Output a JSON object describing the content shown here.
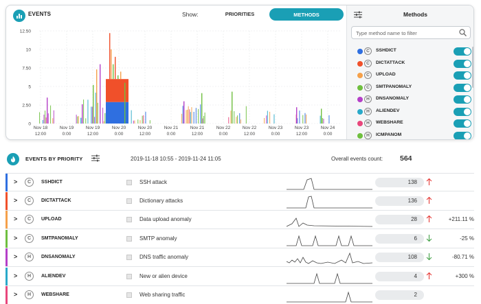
{
  "events_panel": {
    "title": "EVENTS",
    "show_label": "Show:",
    "buttons": {
      "priorities": "PRIORITIES",
      "methods": "METHODS"
    },
    "accent_color": "#1a9fb5",
    "chart_data": {
      "type": "bar",
      "stacked": true,
      "yticks": [
        "12.50",
        "10",
        "7.50",
        "5",
        "2.50",
        "0"
      ],
      "ylim": [
        0,
        12.5
      ],
      "xticks": [
        {
          "date": "Nov 18",
          "time": "12:00"
        },
        {
          "date": "Nov 19",
          "time": "0:00"
        },
        {
          "date": "Nov 19",
          "time": "12:00"
        },
        {
          "date": "Nov 20",
          "time": "0:00"
        },
        {
          "date": "Nov 20",
          "time": "12:00"
        },
        {
          "date": "Nov 21",
          "time": "0:00"
        },
        {
          "date": "Nov 21",
          "time": "12:00"
        },
        {
          "date": "Nov 22",
          "time": "0:00"
        },
        {
          "date": "Nov 22",
          "time": "12:00"
        },
        {
          "date": "Nov 23",
          "time": "0:00"
        },
        {
          "date": "Nov 23",
          "time": "12:00"
        },
        {
          "date": "Nov 24",
          "time": "0:00"
        }
      ],
      "grid": true,
      "series_colors": {
        "SSHDICT": "#2f6fe0",
        "DICTATTACK": "#f0502a",
        "UPLOAD": "#f5a04a",
        "SMTPANOMALY": "#6fbf3f",
        "DNSANOMALY": "#b43fc8",
        "ALIENDEV": "#29a9c9",
        "WEBSHARE": "#e8467c"
      }
    }
  },
  "methods_panel": {
    "title": "Methods",
    "search_placeholder": "Type method name to filter",
    "items": [
      {
        "name": "SSHDICT",
        "letter": "C",
        "color": "#2f6fe0",
        "enabled": true
      },
      {
        "name": "DICTATTACK",
        "letter": "C",
        "color": "#f0502a",
        "enabled": true
      },
      {
        "name": "UPLOAD",
        "letter": "C",
        "color": "#f5a04a",
        "enabled": true
      },
      {
        "name": "SMTPANOMALY",
        "letter": "C",
        "color": "#6fbf3f",
        "enabled": true
      },
      {
        "name": "DNSANOMALY",
        "letter": "H",
        "color": "#b43fc8",
        "enabled": true
      },
      {
        "name": "ALIENDEV",
        "letter": "H",
        "color": "#29a9c9",
        "enabled": true
      },
      {
        "name": "WEBSHARE",
        "letter": "H",
        "color": "#e8467c",
        "enabled": true
      },
      {
        "name": "ICMPANOM",
        "letter": "H",
        "color": "#6fbf3f",
        "enabled": true
      }
    ]
  },
  "priority_panel": {
    "title": "EVENTS BY PRIORITY",
    "time_range": "2019-11-18 10:55 - 2019-11-24 11:05",
    "overall_label": "Overall events count:",
    "overall_count": "564",
    "rows": [
      {
        "color": "#2f6fe0",
        "letter": "C",
        "name": "SSHDICT",
        "description": "SSH attack",
        "count": "138",
        "trend": "up",
        "change": ""
      },
      {
        "color": "#f0502a",
        "letter": "C",
        "name": "DICTATTACK",
        "description": "Dictionary attacks",
        "count": "136",
        "trend": "up",
        "change": ""
      },
      {
        "color": "#f5a04a",
        "letter": "C",
        "name": "UPLOAD",
        "description": "Data upload anomaly",
        "count": "28",
        "trend": "up",
        "change": "+211.11 %"
      },
      {
        "color": "#6fbf3f",
        "letter": "C",
        "name": "SMTPANOMALY",
        "description": "SMTP anomaly",
        "count": "6",
        "trend": "down",
        "change": "-25 %"
      },
      {
        "color": "#b43fc8",
        "letter": "H",
        "name": "DNSANOMALY",
        "description": "DNS traffic anomaly",
        "count": "108",
        "trend": "down",
        "change": "-80.71 %"
      },
      {
        "color": "#29a9c9",
        "letter": "H",
        "name": "ALIENDEV",
        "description": "New or alien device",
        "count": "4",
        "trend": "up",
        "change": "+300 %"
      },
      {
        "color": "#e8467c",
        "letter": "H",
        "name": "WEBSHARE",
        "description": "Web sharing traffic",
        "count": "2",
        "trend": "",
        "change": ""
      }
    ]
  },
  "trend_colors": {
    "up": "#e53935",
    "down": "#43a047"
  }
}
